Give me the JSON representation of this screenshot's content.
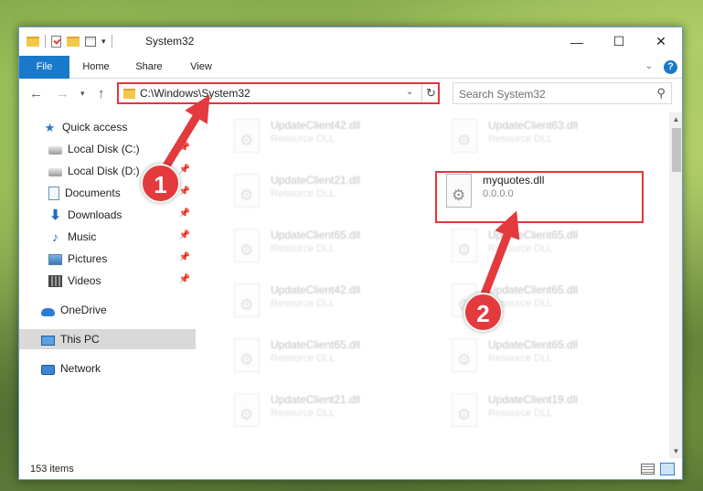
{
  "window": {
    "title": "System32",
    "controls": {
      "minimize": "—",
      "maximize": "☐",
      "close": "✕"
    }
  },
  "ribbon": {
    "tabs": [
      "File",
      "Home",
      "Share",
      "View"
    ],
    "help": "?"
  },
  "address": {
    "path": "C:\\Windows\\System32",
    "refresh_icon": "↻"
  },
  "search": {
    "placeholder": "Search System32"
  },
  "sidebar": {
    "items": [
      {
        "label": "Quick access",
        "icon": "star-icon",
        "pinned": false
      },
      {
        "label": "Local Disk (C:)",
        "icon": "disk-icon",
        "pinned": true
      },
      {
        "label": "Local Disk (D:)",
        "icon": "disk-icon",
        "pinned": true
      },
      {
        "label": "Documents",
        "icon": "documents-icon",
        "pinned": true
      },
      {
        "label": "Downloads",
        "icon": "downloads-icon",
        "pinned": true
      },
      {
        "label": "Music",
        "icon": "music-icon",
        "pinned": true
      },
      {
        "label": "Pictures",
        "icon": "pictures-icon",
        "pinned": true
      },
      {
        "label": "Videos",
        "icon": "videos-icon",
        "pinned": true
      },
      {
        "label": "OneDrive",
        "icon": "onedrive-icon",
        "pinned": false
      },
      {
        "label": "This PC",
        "icon": "pc-icon",
        "pinned": false,
        "selected": true
      },
      {
        "label": "Network",
        "icon": "network-icon",
        "pinned": false
      }
    ]
  },
  "files": {
    "left_column": [
      {
        "name": "UpdateClient42.dll",
        "type": "Resource DLL"
      },
      {
        "name": "UpdateClient21.dll",
        "type": "Resource DLL"
      },
      {
        "name": "UpdateClient65.dll",
        "type": "Resource DLL"
      },
      {
        "name": "UpdateClient42.dll",
        "type": "Resource DLL"
      },
      {
        "name": "UpdateClient65.dll",
        "type": "Resource DLL"
      },
      {
        "name": "UpdateClient21.dll",
        "type": "Resource DLL"
      }
    ],
    "right_column": [
      {
        "name": "UpdateClient63.dll",
        "type": "Resource DLL"
      },
      {
        "name": "myquotes.dll",
        "type": "0.0.0.0",
        "highlighted": true
      },
      {
        "name": "UpdateClient65.dll",
        "type": "Resource DLL"
      },
      {
        "name": "UpdateClient65.dll",
        "type": "Resource DLL"
      },
      {
        "name": "UpdateClient65.dll",
        "type": "Resource DLL"
      },
      {
        "name": "UpdateClient19.dll",
        "type": "Resource DLL"
      }
    ]
  },
  "status": {
    "item_count": "153 items"
  },
  "annotations": {
    "badge_1": "1",
    "badge_2": "2",
    "color": "#e33a3d"
  }
}
